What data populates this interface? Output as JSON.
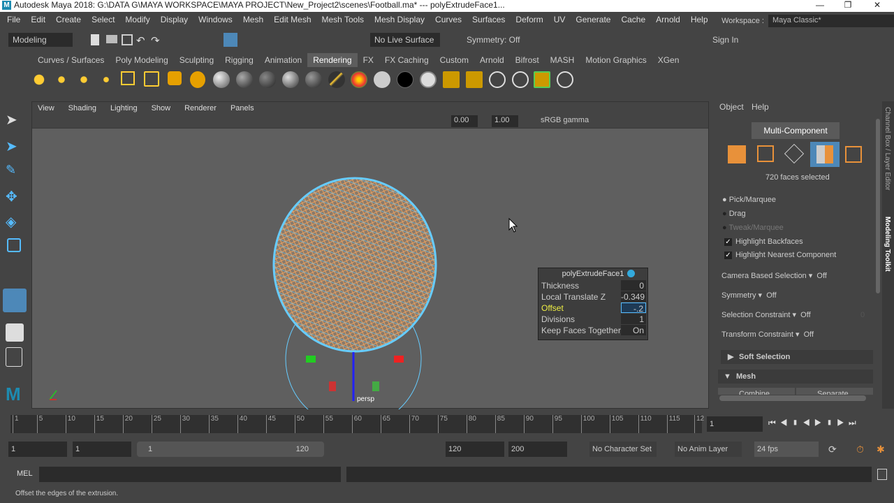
{
  "title": "Autodesk Maya 2018: G:\\DATA G\\MAYA WORKSPACE\\MAYA PROJECT\\New_Project2\\scenes\\Football.ma*  ---  polyExtrudeFace1...",
  "menu": [
    "File",
    "Edit",
    "Create",
    "Select",
    "Modify",
    "Display",
    "Windows",
    "Mesh",
    "Edit Mesh",
    "Mesh Tools",
    "Mesh Display",
    "Curves",
    "Surfaces",
    "Deform",
    "UV",
    "Generate",
    "Cache",
    "Arnold",
    "Help"
  ],
  "workspace": {
    "label": "Workspace :",
    "value": "Maya Classic*"
  },
  "status": {
    "mode": "Modeling",
    "live_surface": "No Live Surface",
    "symmetry": "Symmetry: Off",
    "sign_in": "Sign In"
  },
  "shelf_tabs": [
    "Curves / Surfaces",
    "Poly Modeling",
    "Sculpting",
    "Rigging",
    "Animation",
    "Rendering",
    "FX",
    "FX Caching",
    "Custom",
    "Arnold",
    "Bifrost",
    "MASH",
    "Motion Graphics",
    "XGen"
  ],
  "viewport": {
    "menu": [
      "View",
      "Shading",
      "Lighting",
      "Show",
      "Renderer",
      "Panels"
    ],
    "exposure": "0.00",
    "gamma": "1.00",
    "colorspace": "sRGB gamma",
    "camera": "persp"
  },
  "extrude": {
    "title": "polyExtrudeFace1",
    "rows": [
      {
        "label": "Thickness",
        "value": "0"
      },
      {
        "label": "Local Translate Z",
        "value": "-0.349"
      },
      {
        "label": "Offset",
        "value": "-.2"
      },
      {
        "label": "Divisions",
        "value": "1"
      },
      {
        "label": "Keep Faces Together",
        "value": "On"
      }
    ]
  },
  "toolkit": {
    "menu": [
      "Object",
      "Help"
    ],
    "multi": "Multi-Component",
    "selected": "720 faces selected",
    "modes": [
      "Pick/Marquee",
      "Drag",
      "Tweak/Marquee"
    ],
    "checks": [
      "Highlight Backfaces",
      "Highlight Nearest Component"
    ],
    "options": [
      {
        "label": "Camera Based Selection",
        "value": "Off"
      },
      {
        "label": "Symmetry",
        "value": "Off"
      },
      {
        "label": "Selection Constraint",
        "value": "Off"
      },
      {
        "label": "Transform Constraint",
        "value": "Off"
      }
    ],
    "constraint_num": "0",
    "soft": "Soft Selection",
    "mesh": "Mesh",
    "combine": "Combine",
    "separate": "Separate"
  },
  "sidetabs": [
    "Channel Box / Layer Editor",
    "Modeling Toolkit"
  ],
  "timeline": {
    "ticks": [
      "1",
      "5",
      "10",
      "15",
      "20",
      "25",
      "30",
      "35",
      "40",
      "45",
      "50",
      "55",
      "60",
      "65",
      "70",
      "75",
      "80",
      "85",
      "90",
      "95",
      "100",
      "105",
      "110",
      "115",
      "12"
    ],
    "current": "1"
  },
  "range": {
    "start": "1",
    "pstart": "1",
    "slider_start": "1",
    "slider_end": "120",
    "pend": "120",
    "end": "200",
    "charset": "No Character Set",
    "animlayer": "No Anim Layer",
    "fps": "24 fps"
  },
  "mel": "MEL",
  "help": "Offset the edges of the extrusion."
}
